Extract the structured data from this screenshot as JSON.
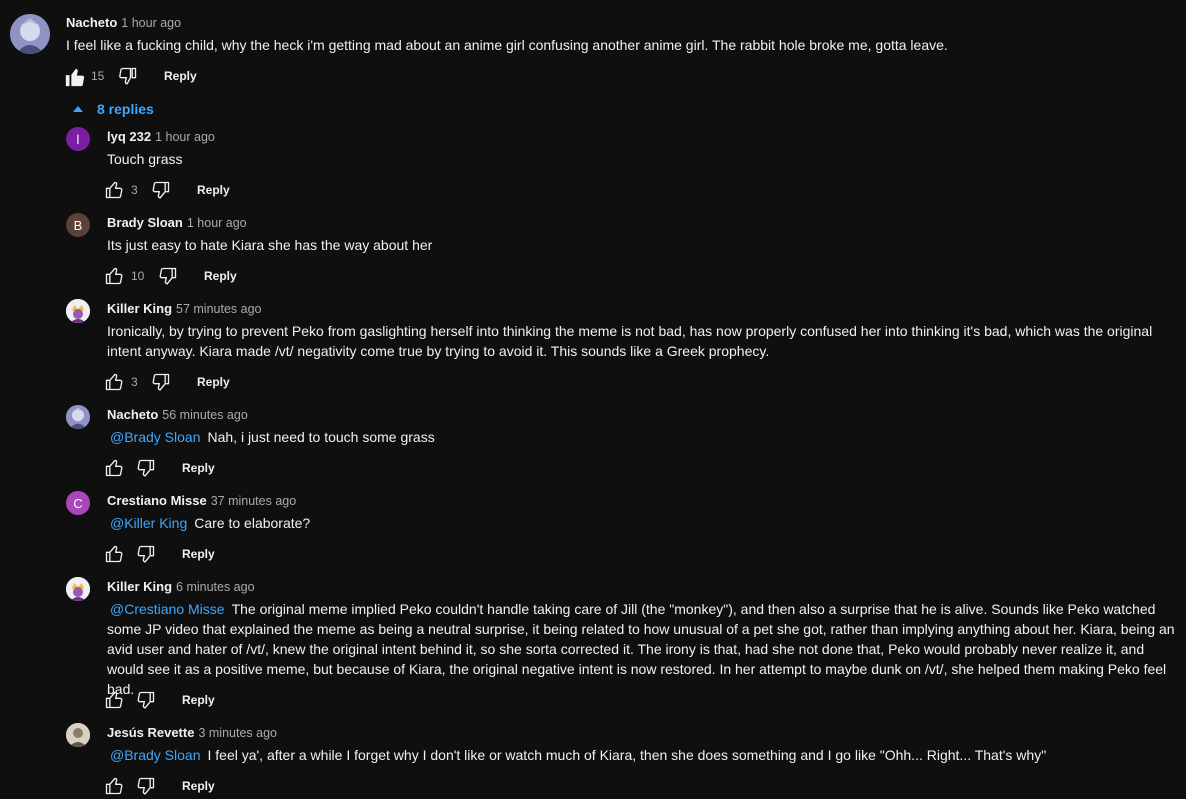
{
  "top_comment": {
    "author": "Nacheto",
    "time": "1 hour ago",
    "text": "I feel like a fucking child, why the heck i'm getting mad about an anime girl confusing another anime girl. The rabbit hole broke me, gotta leave.",
    "likes": "15",
    "reply_label": "Reply"
  },
  "replies_toggle": {
    "label": "8 replies"
  },
  "replies": [
    {
      "author": "lyq 232",
      "time": "1 hour ago",
      "avatar_letter": "l",
      "avatar_color": "#7b1fa2",
      "mention": "",
      "text": "Touch grass",
      "likes": "3",
      "reply_label": "Reply"
    },
    {
      "author": "Brady Sloan",
      "time": "1 hour ago",
      "avatar_letter": "B",
      "avatar_color": "#5d4037",
      "mention": "",
      "text": "Its just easy to hate Kiara she has the way about her",
      "likes": "10",
      "reply_label": "Reply"
    },
    {
      "author": "Killer King",
      "time": "57 minutes ago",
      "avatar_letter": "",
      "avatar_color": "#e8e0f0",
      "mention": "",
      "text": "Ironically, by trying to prevent Peko from gaslighting herself into thinking the meme is not bad, has now properly confused her into thinking it's bad, which was the original intent anyway. Kiara made /vt/ negativity come true by trying to avoid it. This sounds like a Greek prophecy.",
      "likes": "3",
      "reply_label": "Reply"
    },
    {
      "author": "Nacheto",
      "time": "56 minutes ago",
      "avatar_letter": "",
      "avatar_color": "#6b6f9e",
      "mention": "@Brady Sloan",
      "text": "Nah, i just need to touch some grass",
      "likes": "",
      "reply_label": "Reply"
    },
    {
      "author": "Crestiano Misse",
      "time": "37 minutes ago",
      "avatar_letter": "C",
      "avatar_color": "#ab47bc",
      "mention": "@Killer King",
      "text": "Care to elaborate?",
      "likes": "",
      "reply_label": "Reply"
    },
    {
      "author": "Killer King",
      "time": "6 minutes ago",
      "avatar_letter": "",
      "avatar_color": "#e8e0f0",
      "mention": "@Crestiano Misse",
      "text": "The original meme implied Peko couldn't handle taking care of Jill (the \"monkey\"), and then also a surprise that he is alive. Sounds like Peko watched some JP video that explained the meme as being a neutral surprise, it being related to how unusual of a pet she got, rather than implying anything about her. Kiara, being an avid user and hater of /vt/, knew the original intent behind it, so she sorta corrected it. The irony is that, had she not done that, Peko would probably never realize it, and would see it as a positive meme, but because of Kiara, the original negative intent is now restored. In her attempt to maybe dunk on /vt/, she helped them making Peko feel bad.",
      "likes": "",
      "reply_label": "Reply"
    },
    {
      "author": "Jesús Revette",
      "time": "3 minutes ago",
      "avatar_letter": "",
      "avatar_color": "#c9c3b0",
      "mention": "@Brady Sloan",
      "text": "I feel ya', after a while I forget why I don't like or watch much of Kiara, then she does something and I go like \"Ohh... Right... That's why\"",
      "likes": "",
      "reply_label": "Reply"
    }
  ],
  "icons": {
    "like": "thumb-up-icon",
    "dislike": "thumb-down-icon",
    "caret": "caret-up-icon"
  }
}
